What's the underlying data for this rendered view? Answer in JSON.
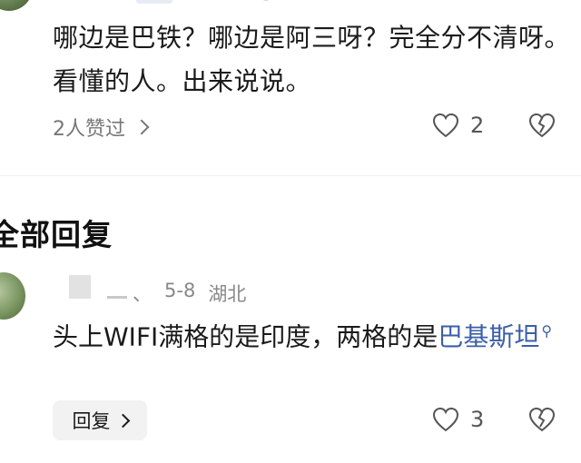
{
  "top_comment": {
    "text": "哪边是巴铁？哪边是阿三呀？完全分不清呀。看懂的人。出来说说。",
    "likers_label": "2人赞过",
    "like_count": "2"
  },
  "section": {
    "title": "全部回复"
  },
  "reply": {
    "name_separator": "、",
    "date": "5-8",
    "location": "湖北",
    "text_plain": "头上WIFI满格的是印度，两格的是",
    "text_link": "巴基斯坦",
    "like_count": "3",
    "reply_label": "回复"
  },
  "icons": {
    "heart": "heart-outline-icon",
    "dislike": "broken-heart-icon",
    "chevron": "chevron-right-icon",
    "search": "search-icon"
  },
  "colors": {
    "link": "#3b5fa8",
    "muted_text": "#777777",
    "reply_button_bg": "#f2f2f2"
  }
}
